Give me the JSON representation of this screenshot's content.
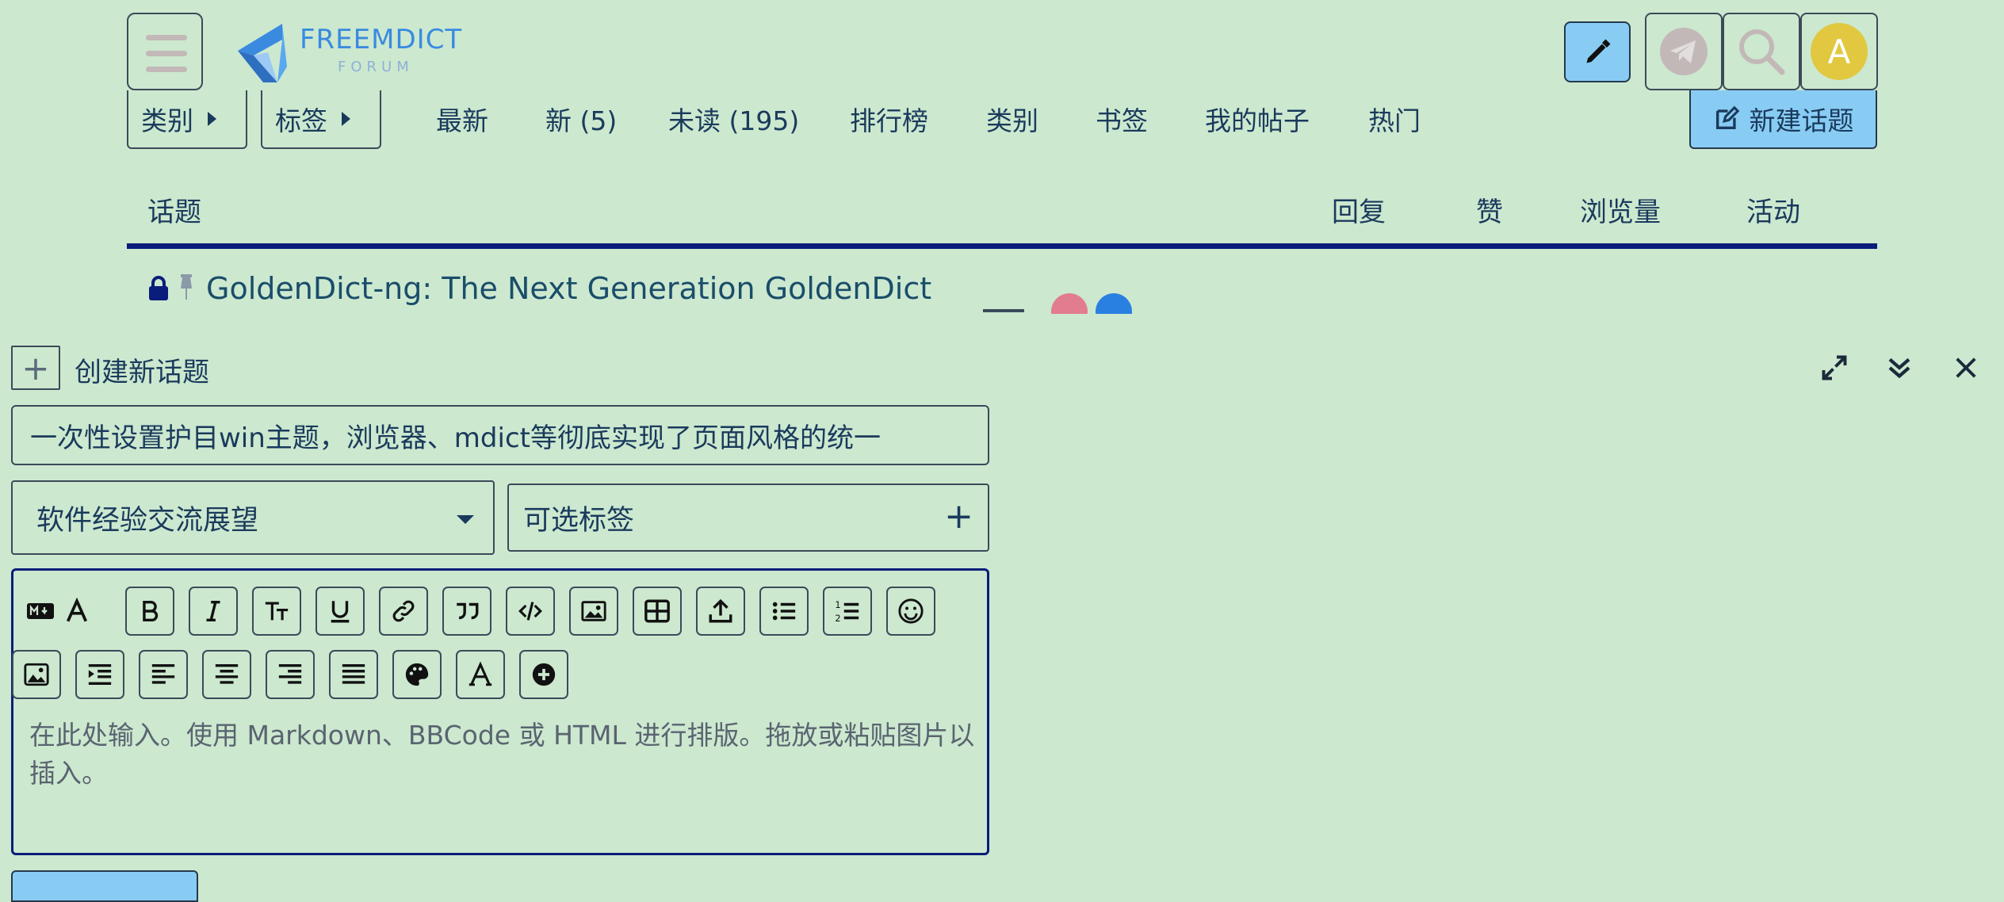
{
  "header": {
    "logo_main": "FREEMDICT",
    "logo_sub": "FORUM",
    "avatar_letter": "A",
    "icons": {
      "menu": "hamburger-icon",
      "edit": "pencil-icon",
      "telegram": "telegram-icon",
      "search": "search-icon"
    },
    "colors": {
      "accent": "#88ccf4",
      "background": "#cce8cf",
      "avatar": "#e1c840",
      "logo": "#3a8be0"
    }
  },
  "nav": {
    "categories_dropdown": "类别",
    "tags_dropdown": "标签",
    "links": [
      "最新",
      "新 (5)",
      "未读 (195)",
      "排行榜",
      "类别",
      "书签",
      "我的帖子",
      "热门"
    ],
    "new_topic_button": "新建话题"
  },
  "topic_list": {
    "headers": {
      "topic": "话题",
      "replies": "回复",
      "likes": "赞",
      "views": "浏览量",
      "activity": "活动"
    },
    "rows": [
      {
        "title": "GoldenDict-ng: The Next Generation GoldenDict",
        "locked": true,
        "pinned": true
      }
    ]
  },
  "composer": {
    "header_title": "创建新话题",
    "title_value": "一次性设置护目win主题，浏览器、mdict等彻底实现了页面风格的统一",
    "category_value": "软件经验交流展望",
    "tags_placeholder": "可选标签",
    "editor_placeholder": "在此处输入。使用 Markdown、BBCode 或 HTML 进行排版。拖放或粘贴图片以插入。"
  }
}
